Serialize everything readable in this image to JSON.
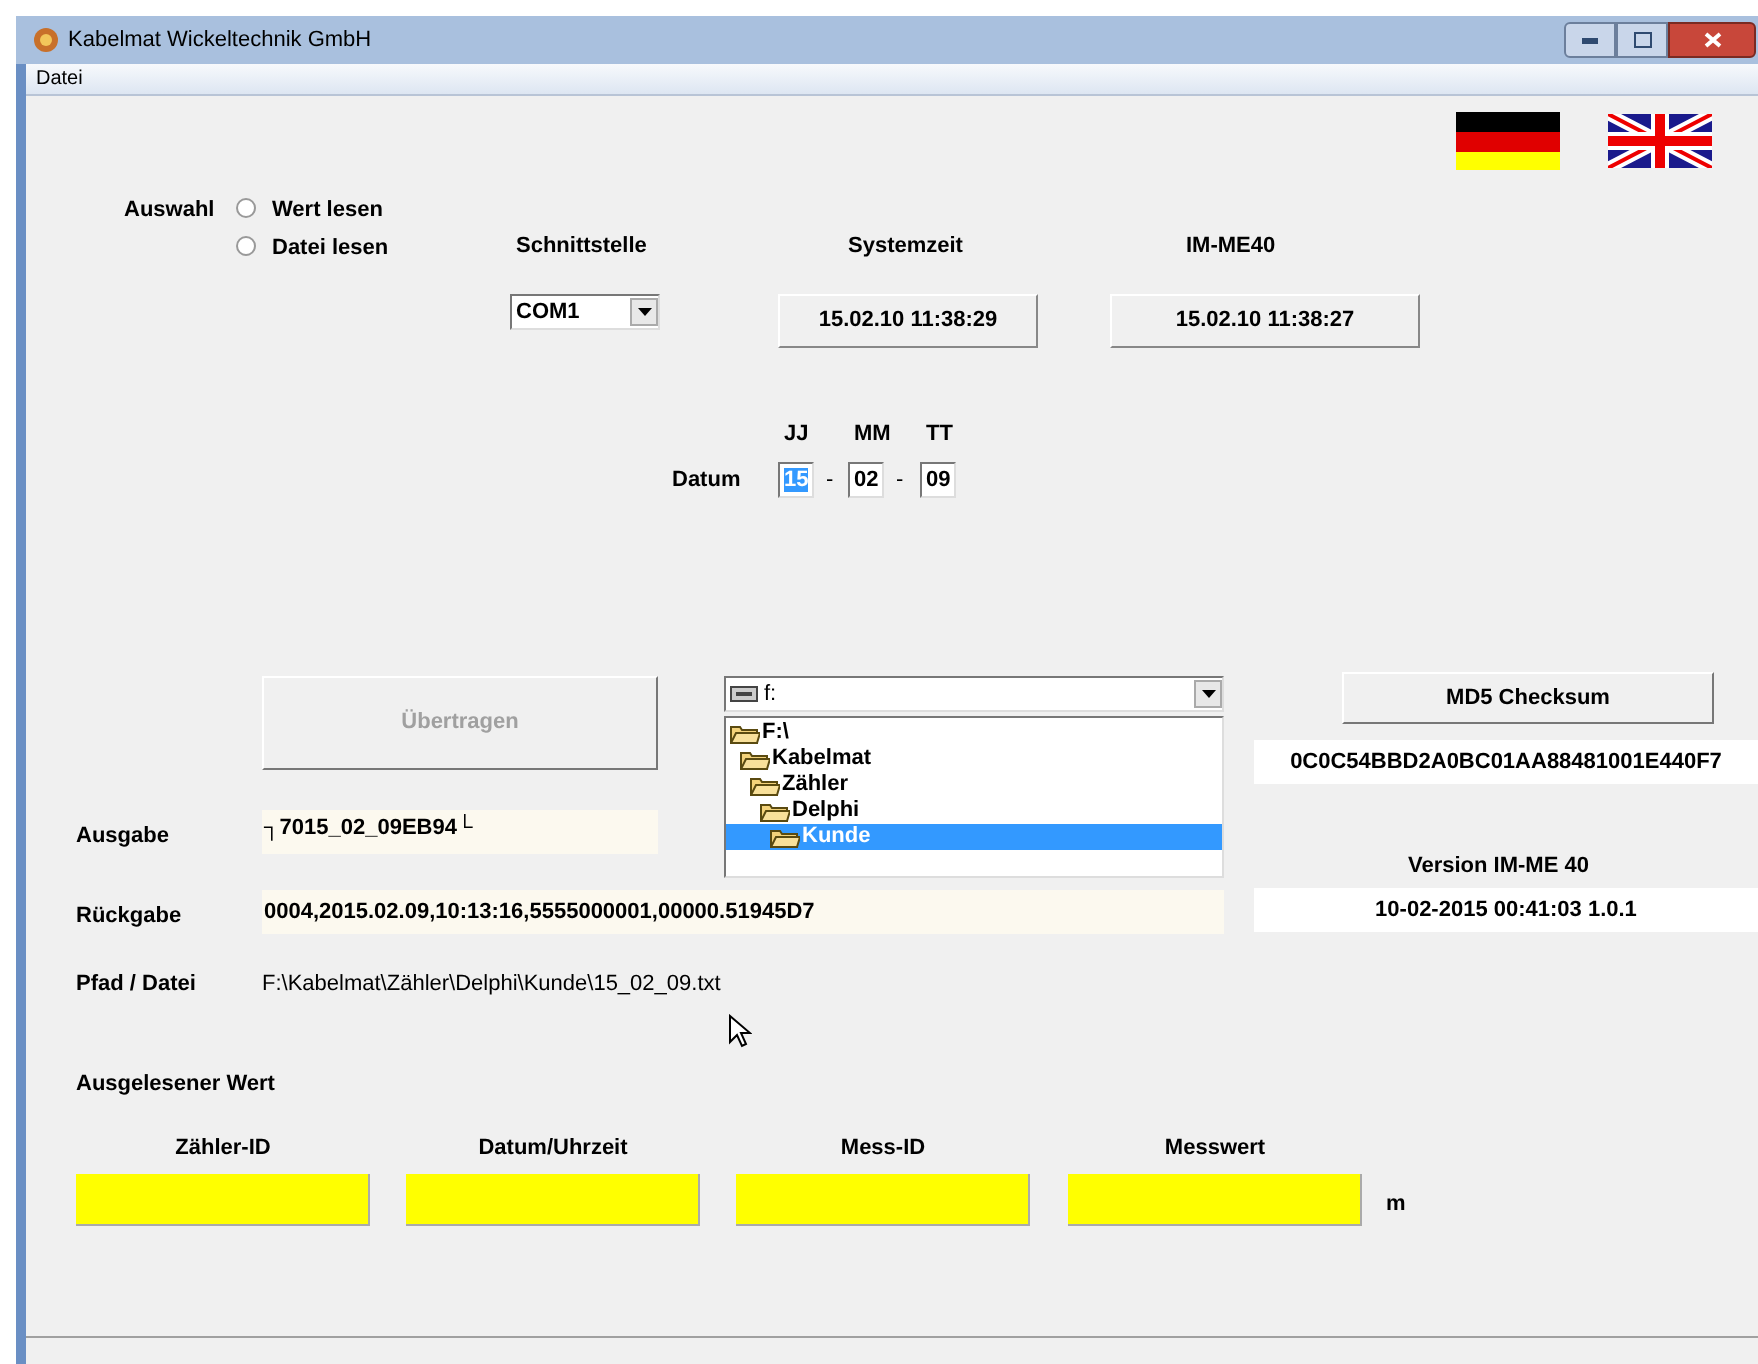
{
  "window": {
    "title": "Kabelmat Wickeltechnik GmbH"
  },
  "menu": [
    "Datei"
  ],
  "auswahl": {
    "label": "Auswahl",
    "options": [
      {
        "label": "Wert lesen",
        "selected": false
      },
      {
        "label": "Datei lesen",
        "selected": false
      }
    ]
  },
  "schnittstelle": {
    "label": "Schnittstelle",
    "value": "COM1"
  },
  "systemzeit": {
    "label": "Systemzeit",
    "value": "15.02.10 11:38:29"
  },
  "im_me40": {
    "label": "IM-ME40",
    "value": "15.02.10 11:38:27"
  },
  "datum": {
    "label": "Datum",
    "parts": [
      {
        "label": "JJ",
        "value": "15",
        "selected": true
      },
      {
        "label": "MM",
        "value": "02",
        "selected": false
      },
      {
        "label": "TT",
        "value": "09",
        "selected": false
      }
    ],
    "separator": "-"
  },
  "uebertragen": {
    "label": "Übertragen",
    "disabled": true
  },
  "drive": {
    "value": "f:"
  },
  "folders": [
    {
      "label": "F:\\",
      "selected": false,
      "children": [
        {
          "label": "Kabelmat",
          "selected": false,
          "children": [
            {
              "label": "Zähler",
              "selected": false,
              "children": [
                {
                  "label": "Delphi",
                  "selected": false,
                  "children": [
                    {
                      "label": "Kunde",
                      "selected": true
                    }
                  ]
                }
              ]
            }
          ]
        }
      ]
    }
  ],
  "md5": {
    "button": "MD5 Checksum",
    "value": "0C0C54BBD2A0BC01AA88481001E440F7"
  },
  "version": {
    "label": "Version IM-ME 40",
    "value": "10-02-2015 00:41:03 1.0.1"
  },
  "ausgabe": {
    "label": "Ausgabe",
    "value": "┐7015_02_09EB94└"
  },
  "rueckgabe": {
    "label": "Rückgabe",
    "value": "0004,2015.02.09,10:13:16,5555000001,00000.51945D7"
  },
  "pfad": {
    "label": "Pfad / Datei",
    "value": "F:\\Kabelmat\\Zähler\\Delphi\\Kunde\\15_02_09.txt"
  },
  "ausgelesen": {
    "title": "Ausgelesener Wert",
    "fields": [
      {
        "label": "Zähler-ID"
      },
      {
        "label": "Datum/Uhrzeit"
      },
      {
        "label": "Mess-ID"
      },
      {
        "label": "Messwert"
      }
    ],
    "unit": "m"
  }
}
